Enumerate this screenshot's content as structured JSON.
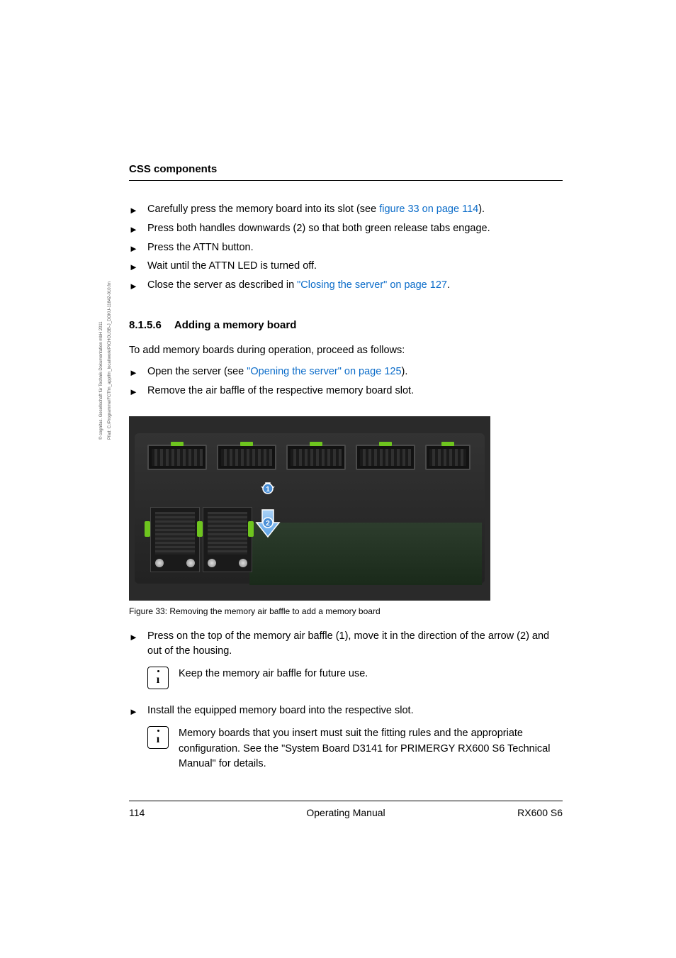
{
  "side": {
    "copyright": "© cognitas. Gesellschaft für Technik-Dokumentation mbH 2011",
    "path": "Pfad: C:/Programme/FCTfm_apptfm_local/work/PICHOU3B-J_DOKU-11842-010.fm"
  },
  "header": {
    "title": "CSS components"
  },
  "bullets1": [
    {
      "prefix": "Carefully press the memory board into its slot (see ",
      "link": "figure 33 on page 114",
      "suffix": ")."
    },
    {
      "text": "Press both handles downwards (2) so that both green release tabs engage."
    },
    {
      "text": "Press the ATTN button."
    },
    {
      "text": "Wait until the ATTN LED is turned off."
    },
    {
      "prefix": "Close the server as described in ",
      "link": "\"Closing the server\" on page 127",
      "suffix": "."
    }
  ],
  "section": {
    "number": "8.1.5.6",
    "title": "Adding a memory board"
  },
  "intro": "To add memory boards during operation, proceed as follows:",
  "bullets2": [
    {
      "prefix": "Open the server (see ",
      "link": "\"Opening the server\" on page 125",
      "suffix": ")."
    },
    {
      "text": "Remove the air baffle of the respective memory board slot."
    }
  ],
  "figure": {
    "caption": "Figure 33: Removing the memory air baffle to add a memory board",
    "marker1": "1",
    "marker2": "2"
  },
  "bullets3": [
    {
      "text": "Press on the top of the memory air baffle (1), move it in the direction of the arrow (2) and out of the housing."
    }
  ],
  "note1": "Keep the memory air baffle for future use.",
  "bullets4": [
    {
      "text": "Install the equipped memory board into the respective slot."
    }
  ],
  "note2": "Memory boards that you insert must suit the fitting rules and the appropriate configuration. See the \"System Board D3141 for PRIMERGY RX600 S6 Technical Manual\" for details.",
  "footer": {
    "page": "114",
    "center": "Operating Manual",
    "right": "RX600 S6"
  }
}
